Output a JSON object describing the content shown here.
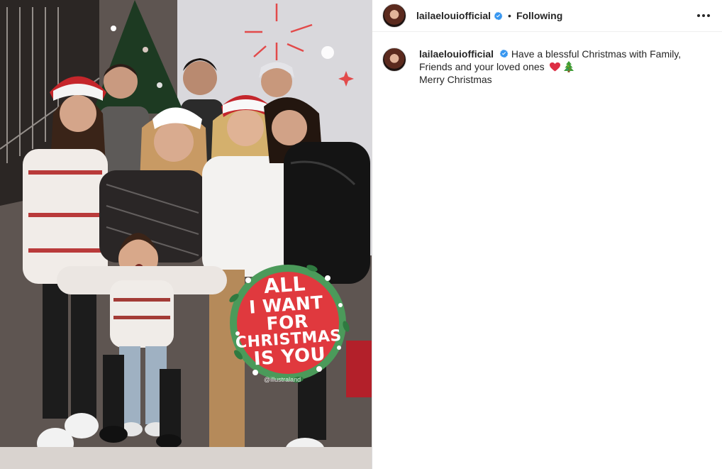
{
  "header": {
    "username": "lailaelouiofficial",
    "verified": true,
    "separator": "•",
    "follow_status": "Following",
    "more_icon": "more-horizontal-icon"
  },
  "caption": {
    "username": "lailaelouiofficial",
    "verified": true,
    "text": "Have a blessful Christmas with Family, Friends and your loved ones",
    "emojis": [
      "red-heart",
      "christmas-tree"
    ],
    "line2": "Merry Christmas"
  },
  "photo": {
    "sticker": {
      "line1": "ALL",
      "line2": "I WANT FOR",
      "line3": "CHRISTMAS",
      "line4": "IS YOU"
    },
    "credit": "@illustraland"
  },
  "colors": {
    "verified_blue": "#3897f0",
    "sticker_red": "#e0393e",
    "sticker_green": "#4b9a5a",
    "divider": "#dbdbdb"
  }
}
